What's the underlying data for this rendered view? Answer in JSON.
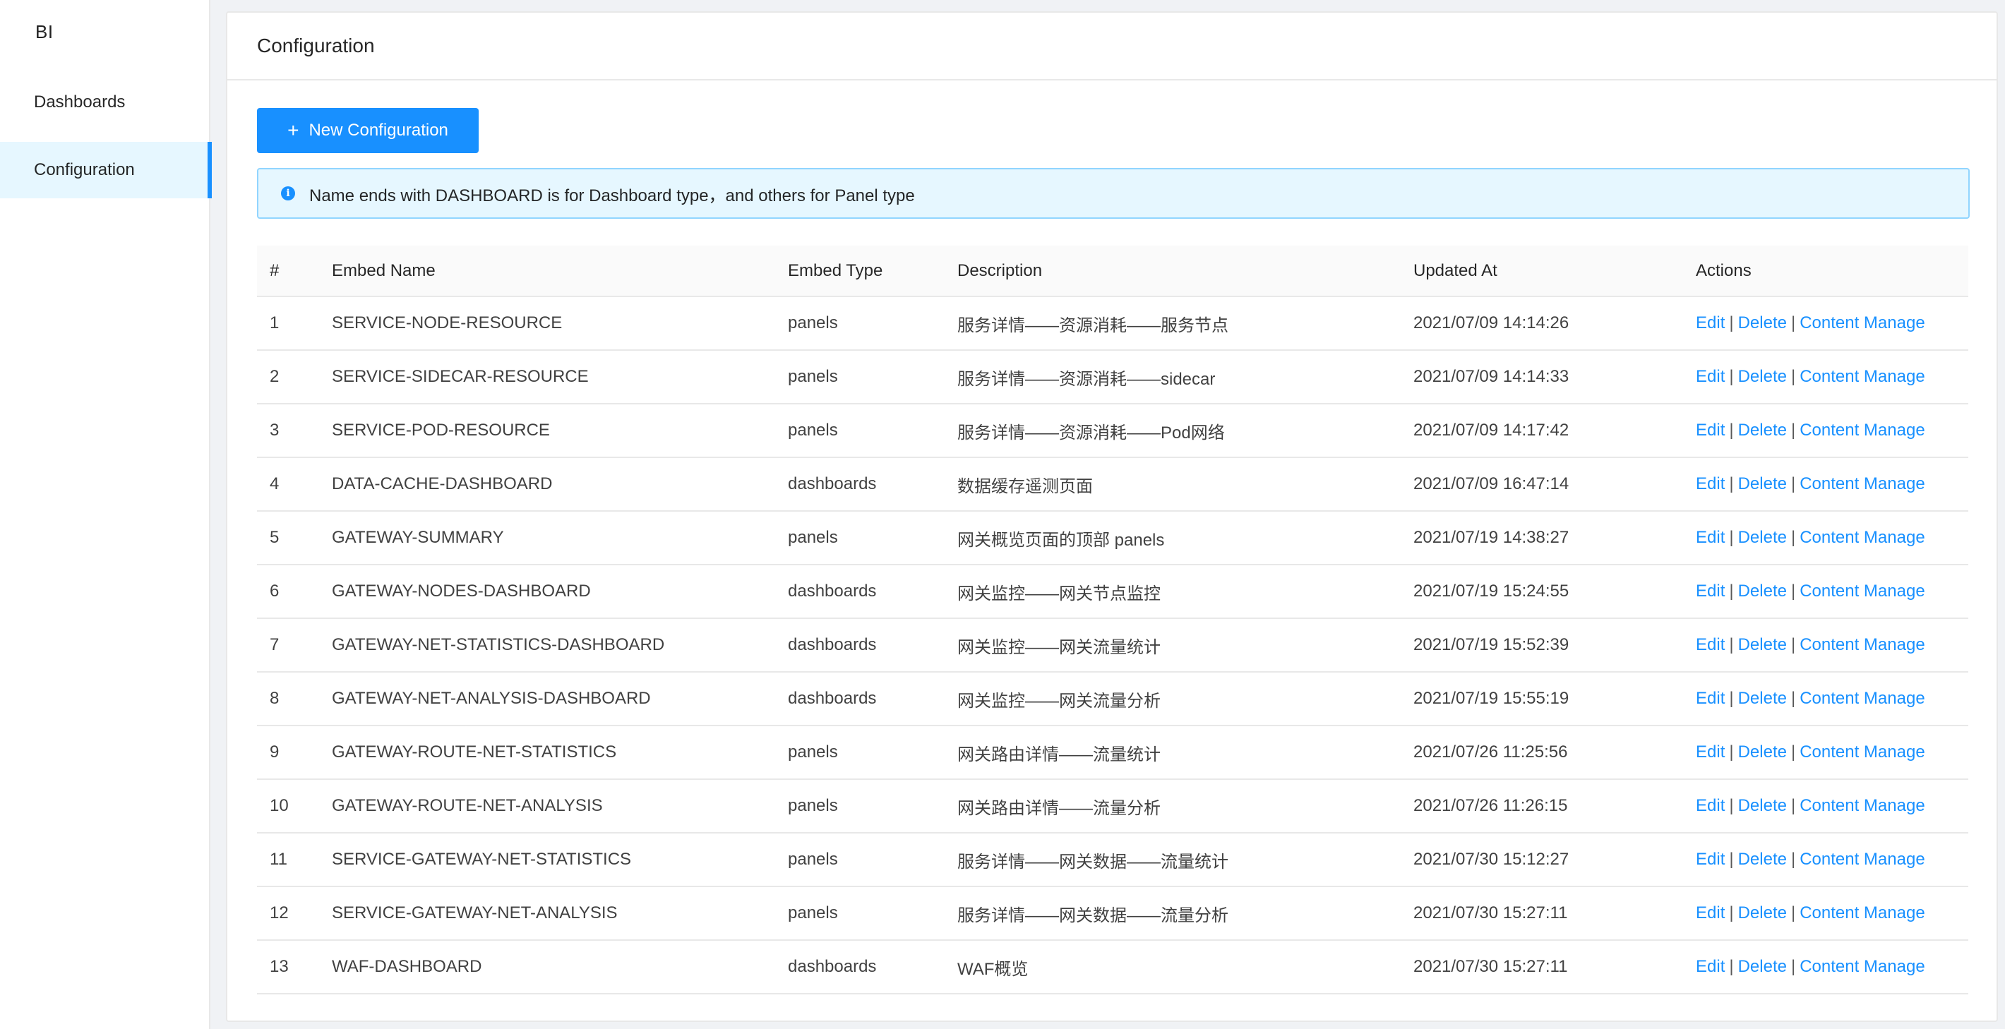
{
  "sidebar": {
    "logo": "BI",
    "items": [
      {
        "label": "Dashboards"
      },
      {
        "label": "Configuration"
      }
    ]
  },
  "page": {
    "title": "Configuration",
    "new_button_label": "New Configuration",
    "info_text": "Name ends with DASHBOARD is for Dashboard type，and others for Panel type"
  },
  "table": {
    "columns": [
      "#",
      "Embed Name",
      "Embed Type",
      "Description",
      "Updated At",
      "Actions"
    ],
    "action_labels": {
      "edit": "Edit",
      "delete": "Delete",
      "content": "Content Manage",
      "separator": "|"
    },
    "rows": [
      {
        "id": "1",
        "name": "SERVICE-NODE-RESOURCE",
        "type": "panels",
        "description": "服务详情——资源消耗——服务节点",
        "updated": "2021/07/09 14:14:26"
      },
      {
        "id": "2",
        "name": "SERVICE-SIDECAR-RESOURCE",
        "type": "panels",
        "description": "服务详情——资源消耗——sidecar",
        "updated": "2021/07/09 14:14:33"
      },
      {
        "id": "3",
        "name": "SERVICE-POD-RESOURCE",
        "type": "panels",
        "description": "服务详情——资源消耗——Pod网络",
        "updated": "2021/07/09 14:17:42"
      },
      {
        "id": "4",
        "name": "DATA-CACHE-DASHBOARD",
        "type": "dashboards",
        "description": "数据缓存遥测页面",
        "updated": "2021/07/09 16:47:14"
      },
      {
        "id": "5",
        "name": "GATEWAY-SUMMARY",
        "type": "panels",
        "description": "网关概览页面的顶部 panels",
        "updated": "2021/07/19 14:38:27"
      },
      {
        "id": "6",
        "name": "GATEWAY-NODES-DASHBOARD",
        "type": "dashboards",
        "description": "网关监控——网关节点监控",
        "updated": "2021/07/19 15:24:55"
      },
      {
        "id": "7",
        "name": "GATEWAY-NET-STATISTICS-DASHBOARD",
        "type": "dashboards",
        "description": "网关监控——网关流量统计",
        "updated": "2021/07/19 15:52:39"
      },
      {
        "id": "8",
        "name": "GATEWAY-NET-ANALYSIS-DASHBOARD",
        "type": "dashboards",
        "description": "网关监控——网关流量分析",
        "updated": "2021/07/19 15:55:19"
      },
      {
        "id": "9",
        "name": "GATEWAY-ROUTE-NET-STATISTICS",
        "type": "panels",
        "description": "网关路由详情——流量统计",
        "updated": "2021/07/26 11:25:56"
      },
      {
        "id": "10",
        "name": "GATEWAY-ROUTE-NET-ANALYSIS",
        "type": "panels",
        "description": "网关路由详情——流量分析",
        "updated": "2021/07/26 11:26:15"
      },
      {
        "id": "11",
        "name": "SERVICE-GATEWAY-NET-STATISTICS",
        "type": "panels",
        "description": "服务详情——网关数据——流量统计",
        "updated": "2021/07/30 15:12:27"
      },
      {
        "id": "12",
        "name": "SERVICE-GATEWAY-NET-ANALYSIS",
        "type": "panels",
        "description": "服务详情——网关数据——流量分析",
        "updated": "2021/07/30 15:27:11"
      },
      {
        "id": "13",
        "name": "WAF-DASHBOARD",
        "type": "dashboards",
        "description": "WAF概览",
        "updated": "2021/07/30 15:27:11"
      }
    ]
  }
}
